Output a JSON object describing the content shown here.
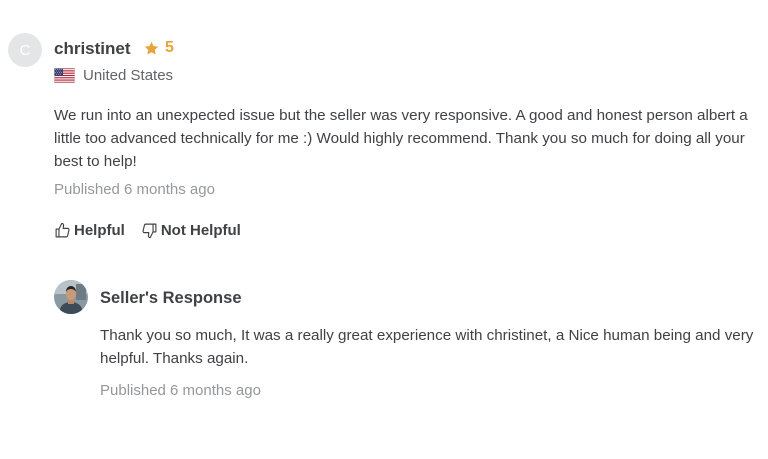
{
  "review": {
    "avatar_letter": "C",
    "username": "christinet",
    "rating": "5",
    "country": "United States",
    "flag_icon": "us-flag-icon",
    "text": "We run into an unexpected issue but the seller was very responsive. A good and honest person albert a little too advanced technically for me :) Would highly recommend. Thank you so much for doing all your best to help!",
    "published": "Published 6 months ago",
    "helpful_label": "Helpful",
    "not_helpful_label": "Not Helpful"
  },
  "seller_response": {
    "title": "Seller's Response",
    "text": "Thank you so much, It was a really great experience with christinet, a Nice human being and very helpful. Thanks again.",
    "published": "Published 6 months ago"
  },
  "colors": {
    "star": "#e8a33d",
    "text": "#404145",
    "muted": "#95979d",
    "avatar_bg": "#e4e5e7"
  }
}
